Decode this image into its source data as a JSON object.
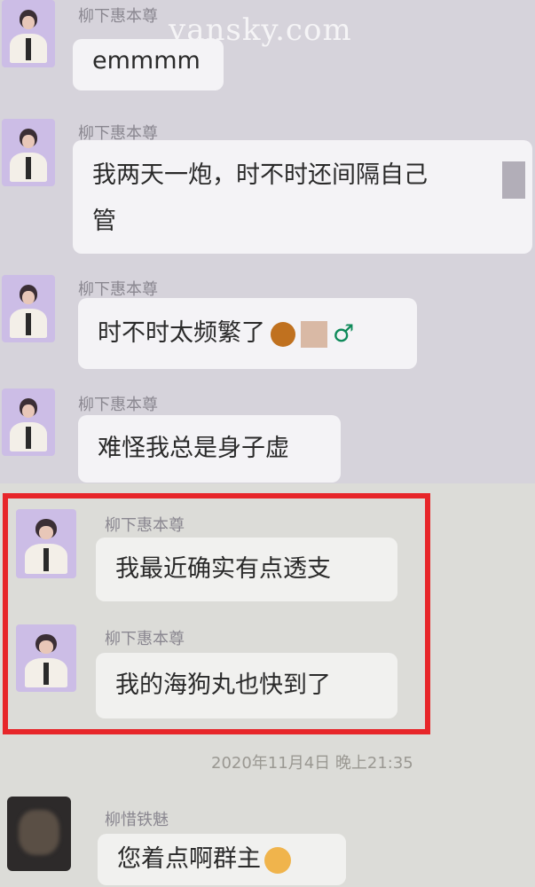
{
  "watermark": "vansky.com",
  "messages": [
    {
      "sender": "柳下惠本尊",
      "text": "emmmm"
    },
    {
      "sender": "柳下惠本尊",
      "text": "我两天一炮，时不时还间隔自己",
      "text_cont": "管"
    },
    {
      "sender": "柳下惠本尊",
      "text": "时不时太频繁了",
      "emoji_end": "♂"
    },
    {
      "sender": "柳下惠本尊",
      "text": "难怪我总是身子虚"
    },
    {
      "sender": "柳下惠本尊",
      "text": "我最近确实有点透支"
    },
    {
      "sender": "柳下惠本尊",
      "text": "我的海狗丸也快到了"
    },
    {
      "sender": "柳惜铁魅",
      "text": "您着点啊群主"
    }
  ],
  "timestamp": "2020年11月4日 晚上21:35",
  "colors": {
    "highlight": "#e7262a",
    "bubble": "#f4f3f6"
  }
}
